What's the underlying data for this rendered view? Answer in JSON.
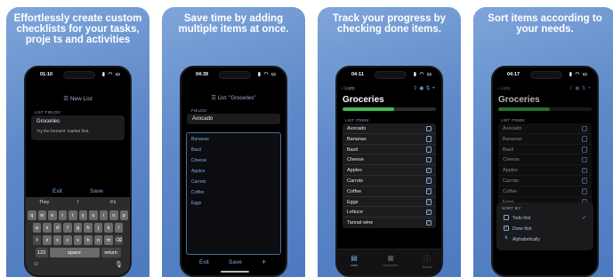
{
  "panels": [
    {
      "caption": "Effortlessly create custom checklists for your tasks, proje ts and activities"
    },
    {
      "caption": "Save time by adding multiple items at once."
    },
    {
      "caption": "Track your progress by checking done items."
    },
    {
      "caption": "Sort items according to your needs."
    }
  ],
  "phone1": {
    "time": "01:10",
    "title": "New List",
    "fields_label": "LIST FIELDS:",
    "name_value": "Groceries",
    "desc_value": "Try the farmers' market first.",
    "exit": "Exit",
    "save": "Save",
    "suggestions": [
      "They",
      "I",
      "It's"
    ],
    "rows": [
      [
        "q",
        "w",
        "e",
        "r",
        "t",
        "y",
        "u",
        "i",
        "o",
        "p"
      ],
      [
        "a",
        "s",
        "d",
        "f",
        "g",
        "h",
        "j",
        "k",
        "l"
      ],
      [
        "⇧",
        "z",
        "x",
        "c",
        "v",
        "b",
        "n",
        "m",
        "⌫"
      ]
    ],
    "key_123": "123",
    "key_space": "space",
    "key_return": "return"
  },
  "phone2": {
    "time": "04:39",
    "title": "List: \"Groceries\"",
    "fields_label": "FIELDS:",
    "field_value": "Avocado",
    "items": [
      "Bananas",
      "Basil",
      "Cheese",
      "Apples",
      "Carrots",
      "Coffee",
      "Eggs"
    ],
    "exit": "Exit",
    "save": "Save",
    "add": "+"
  },
  "phone3": {
    "time": "04:11",
    "back": "Lists",
    "title": "Groceries",
    "progress": 0.55,
    "items_label": "LIST ITEMS:",
    "items": [
      {
        "name": "Avocado",
        "done": false
      },
      {
        "name": "Bananas",
        "done": false
      },
      {
        "name": "Basil",
        "done": false
      },
      {
        "name": "Cheese",
        "done": false
      },
      {
        "name": "Apples",
        "done": true
      },
      {
        "name": "Carrots",
        "done": true
      },
      {
        "name": "Coffee",
        "done": true
      },
      {
        "name": "Eggs",
        "done": true
      },
      {
        "name": "Lettuce",
        "done": true
      },
      {
        "name": "Tannat wine",
        "done": true
      }
    ],
    "tabs": [
      "Lists",
      "Templates",
      "About"
    ]
  },
  "phone4": {
    "time": "04:17",
    "back": "Lists",
    "title": "Groceries",
    "progress": 0.55,
    "items_label": "LIST ITEMS:",
    "items": [
      {
        "name": "Avocado",
        "done": false
      },
      {
        "name": "Bananas",
        "done": false
      },
      {
        "name": "Basil",
        "done": false
      },
      {
        "name": "Cheese",
        "done": false
      },
      {
        "name": "Apples",
        "done": true
      },
      {
        "name": "Carrots",
        "done": true
      },
      {
        "name": "Coffee",
        "done": true
      },
      {
        "name": "Eggs",
        "done": true
      }
    ],
    "sort_label": "SORT BY:",
    "sort_options": [
      {
        "label": "Todo first",
        "selected": true
      },
      {
        "label": "Done first",
        "selected": false
      },
      {
        "label": "Alphabetically",
        "selected": false
      }
    ]
  },
  "colors": {
    "accent": "#7ea8d8",
    "progress": "#3fb950",
    "panel": "#5f89c9"
  }
}
